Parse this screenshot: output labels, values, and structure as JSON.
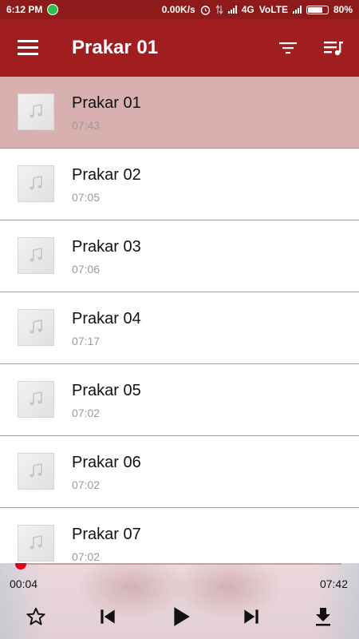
{
  "status_bar": {
    "time": "6:12 PM",
    "speed": "0.00K/s",
    "network": "4G",
    "volte": "VoLTE",
    "battery": "80%",
    "battery_level": 0.8
  },
  "app_bar": {
    "title": "Prakar 01"
  },
  "tracks": [
    {
      "title": "Prakar 01",
      "duration": "07:43",
      "active": true
    },
    {
      "title": "Prakar 02",
      "duration": "07:05",
      "active": false
    },
    {
      "title": "Prakar 03",
      "duration": "07:06",
      "active": false
    },
    {
      "title": "Prakar 04",
      "duration": "07:17",
      "active": false
    },
    {
      "title": "Prakar 05",
      "duration": "07:02",
      "active": false
    },
    {
      "title": "Prakar 06",
      "duration": "07:02",
      "active": false
    },
    {
      "title": "Prakar 07",
      "duration": "07:02",
      "active": false
    }
  ],
  "player": {
    "current_time": "00:04",
    "total_time": "07:42",
    "progress": 0.009
  },
  "colors": {
    "status_bar": "#8e1b1c",
    "app_bar": "#a01e1f",
    "active_row": "#d9b0b0",
    "seek_knob": "#e0001c"
  }
}
